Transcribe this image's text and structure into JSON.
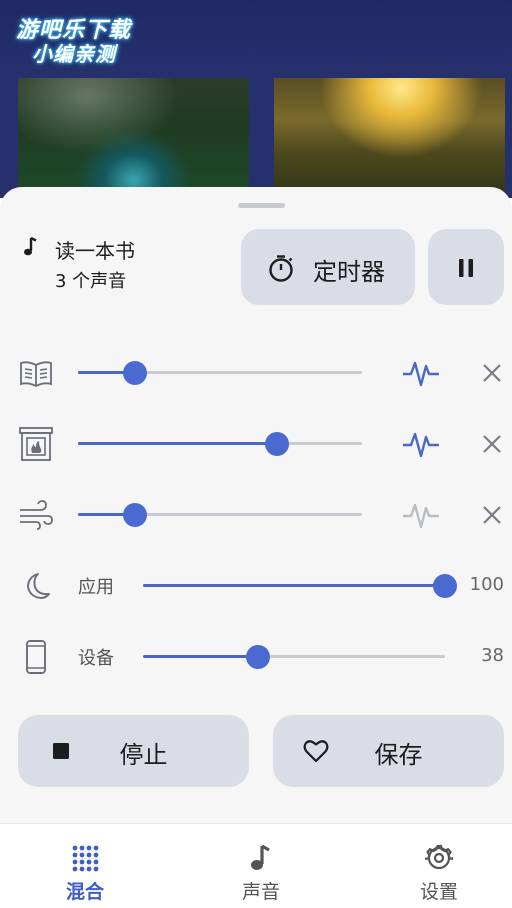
{
  "header": {
    "logo_line1": "游吧乐下载",
    "logo_line2": "小编亲测"
  },
  "mix": {
    "title": "读一本书",
    "subtitle": "3 个声音",
    "timer_label": "定时器"
  },
  "sounds": [
    {
      "icon": "book-icon",
      "level": 0.2,
      "active": true
    },
    {
      "icon": "fireplace-icon",
      "level": 0.7,
      "active": true
    },
    {
      "icon": "wind-icon",
      "level": 0.2,
      "active": false
    }
  ],
  "volumes": [
    {
      "icon": "moon-icon",
      "label": "应用",
      "value": "100",
      "level": 1.0
    },
    {
      "icon": "phone-icon",
      "label": "设备",
      "value": "38",
      "level": 0.38
    }
  ],
  "actions": {
    "stop_label": "停止",
    "save_label": "保存"
  },
  "nav": {
    "items": [
      {
        "label": "混合",
        "icon": "grid-dots-icon",
        "active": true
      },
      {
        "label": "声音",
        "icon": "music-note-icon",
        "active": false
      },
      {
        "label": "设置",
        "icon": "gear-icon",
        "active": false
      }
    ]
  },
  "colors": {
    "accent": "#4a67c8",
    "header_bg": "#26306d",
    "button_bg": "#d9dde6",
    "inactive_pulse": "#b9bcc4"
  }
}
